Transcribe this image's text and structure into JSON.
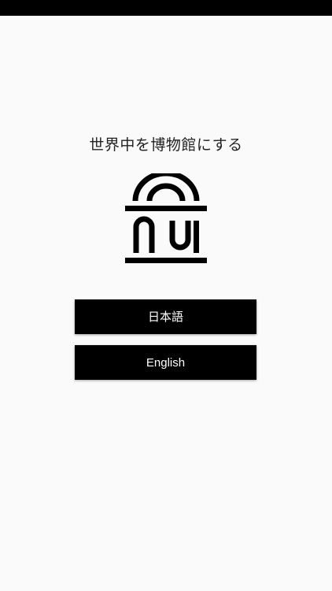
{
  "tagline": "世界中を博物館にする",
  "logo": {
    "icon": "museum-logo-icon"
  },
  "buttons": {
    "japanese": "日本語",
    "english": "English"
  },
  "colors": {
    "background": "#fafafa",
    "status_bar": "#000000",
    "button_bg": "#000000",
    "button_text": "#ffffff",
    "text": "#222222"
  }
}
